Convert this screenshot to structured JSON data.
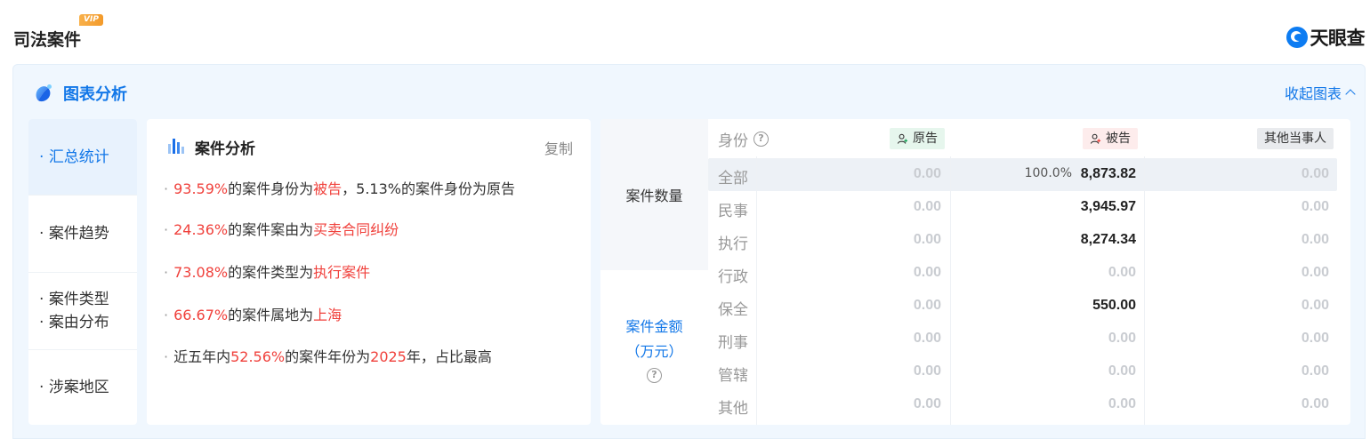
{
  "header": {
    "title": "司法案件",
    "vip_badge": "VIP",
    "brand": "天眼查"
  },
  "panel": {
    "title": "图表分析",
    "collapse_label": "收起图表"
  },
  "sidebar": {
    "items": [
      {
        "lines": [
          "汇总统计"
        ],
        "active": true
      },
      {
        "lines": [
          "案件趋势"
        ],
        "active": false
      },
      {
        "lines": [
          "案件类型",
          "案由分布"
        ],
        "active": false
      },
      {
        "lines": [
          "涉案地区"
        ],
        "active": false
      }
    ]
  },
  "analysis": {
    "title": "案件分析",
    "copy_label": "复制",
    "bullets": [
      {
        "parts": [
          {
            "t": "93.59%",
            "red": true
          },
          {
            "t": "的案件身份为"
          },
          {
            "t": "被告",
            "red": true
          },
          {
            "t": "，5.13%的案件身份为原告"
          }
        ]
      },
      {
        "parts": [
          {
            "t": "24.36%",
            "red": true
          },
          {
            "t": "的案件案由为"
          },
          {
            "t": "买卖合同纠纷",
            "red": true
          }
        ]
      },
      {
        "parts": [
          {
            "t": "73.08%",
            "red": true
          },
          {
            "t": "的案件类型为"
          },
          {
            "t": "执行案件",
            "red": true
          }
        ]
      },
      {
        "parts": [
          {
            "t": "66.67%",
            "red": true
          },
          {
            "t": "的案件属地为"
          },
          {
            "t": "上海",
            "red": true
          }
        ]
      },
      {
        "parts": [
          {
            "t": "近五年内"
          },
          {
            "t": "52.56%",
            "red": true
          },
          {
            "t": "的案件年份为"
          },
          {
            "t": "2025",
            "red": true
          },
          {
            "t": "年，占比最高"
          }
        ]
      }
    ]
  },
  "stats": {
    "metric_count_label": "案件数量",
    "metric_amount_line1": "案件金额",
    "metric_amount_line2": "（万元）",
    "help_glyph": "?",
    "role_header": "身份",
    "columns": {
      "plaintiff": "原告",
      "defendant": "被告",
      "other": "其他当事人"
    },
    "rows": [
      {
        "label": "全部",
        "plaintiff": "0.00",
        "defendant": "8,873.82",
        "defendant_pct": "100.0%",
        "other": "0.00",
        "highlight": true
      },
      {
        "label": "民事",
        "plaintiff": "0.00",
        "defendant": "3,945.97",
        "other": "0.00"
      },
      {
        "label": "执行",
        "plaintiff": "0.00",
        "defendant": "8,274.34",
        "other": "0.00"
      },
      {
        "label": "行政",
        "plaintiff": "0.00",
        "defendant": "0.00",
        "other": "0.00"
      },
      {
        "label": "保全",
        "plaintiff": "0.00",
        "defendant": "550.00",
        "other": "0.00"
      },
      {
        "label": "刑事",
        "plaintiff": "0.00",
        "defendant": "0.00",
        "other": "0.00"
      },
      {
        "label": "管辖",
        "plaintiff": "0.00",
        "defendant": "0.00",
        "other": "0.00"
      },
      {
        "label": "其他",
        "plaintiff": "0.00",
        "defendant": "0.00",
        "other": "0.00"
      }
    ]
  },
  "colors": {
    "accent": "#1277e8",
    "highlight_red": "#f0413c",
    "panel_bg": "#f0f7fe"
  }
}
